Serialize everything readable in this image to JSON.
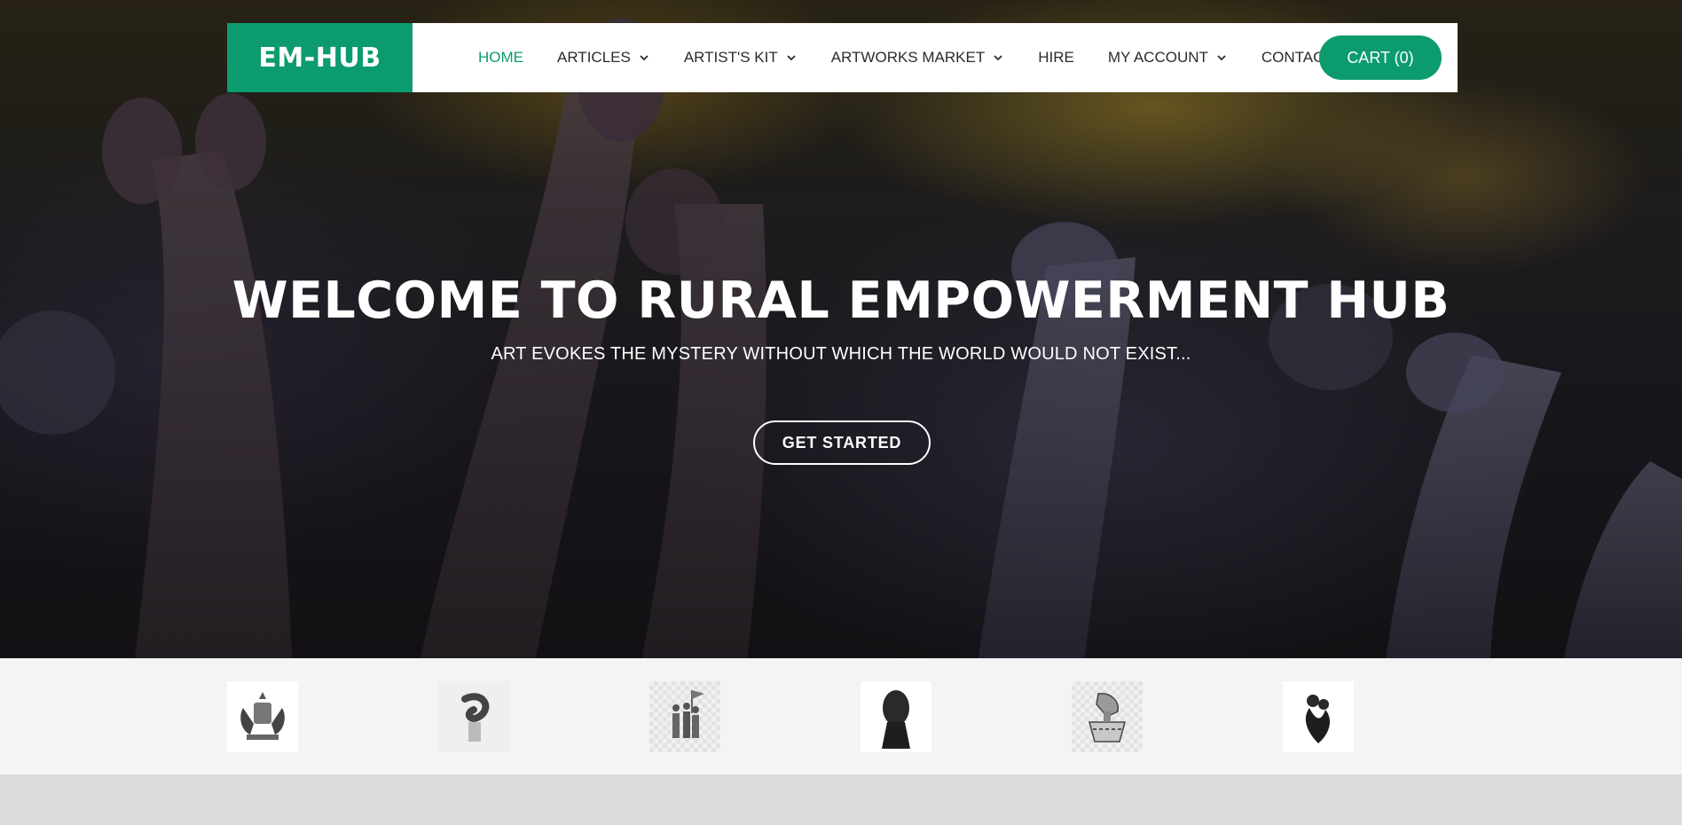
{
  "brand": {
    "logo_text": "EM-HUB",
    "accent_color": "#0c9b6f"
  },
  "nav": {
    "items": [
      {
        "label": "HOME",
        "active": true,
        "dropdown": false
      },
      {
        "label": "ARTICLES",
        "active": false,
        "dropdown": true
      },
      {
        "label": "ARTIST'S KIT",
        "active": false,
        "dropdown": true
      },
      {
        "label": "ARTWORKS MARKET",
        "active": false,
        "dropdown": true
      },
      {
        "label": "HIRE",
        "active": false,
        "dropdown": false
      },
      {
        "label": "MY ACCOUNT",
        "active": false,
        "dropdown": true
      },
      {
        "label": "CONTACT",
        "active": false,
        "dropdown": false
      }
    ],
    "cart_label": "CART (0)"
  },
  "hero": {
    "title": "WELCOME TO RURAL EMPOWERMENT HUB",
    "subtitle": "ART EVOKES THE MYSTERY WITHOUT WHICH THE WORLD WOULD NOT EXIST...",
    "cta_label": "GET STARTED",
    "background": "carved-giraffe-sculptures-photo"
  },
  "clients": [
    {
      "icon": "coat-of-arms-icon"
    },
    {
      "icon": "abstract-sculpture-icon"
    },
    {
      "icon": "soldiers-statue-icon"
    },
    {
      "icon": "stone-head-bust-icon"
    },
    {
      "icon": "zimbabwe-bird-icon"
    },
    {
      "icon": "embrace-sculpture-icon"
    }
  ]
}
